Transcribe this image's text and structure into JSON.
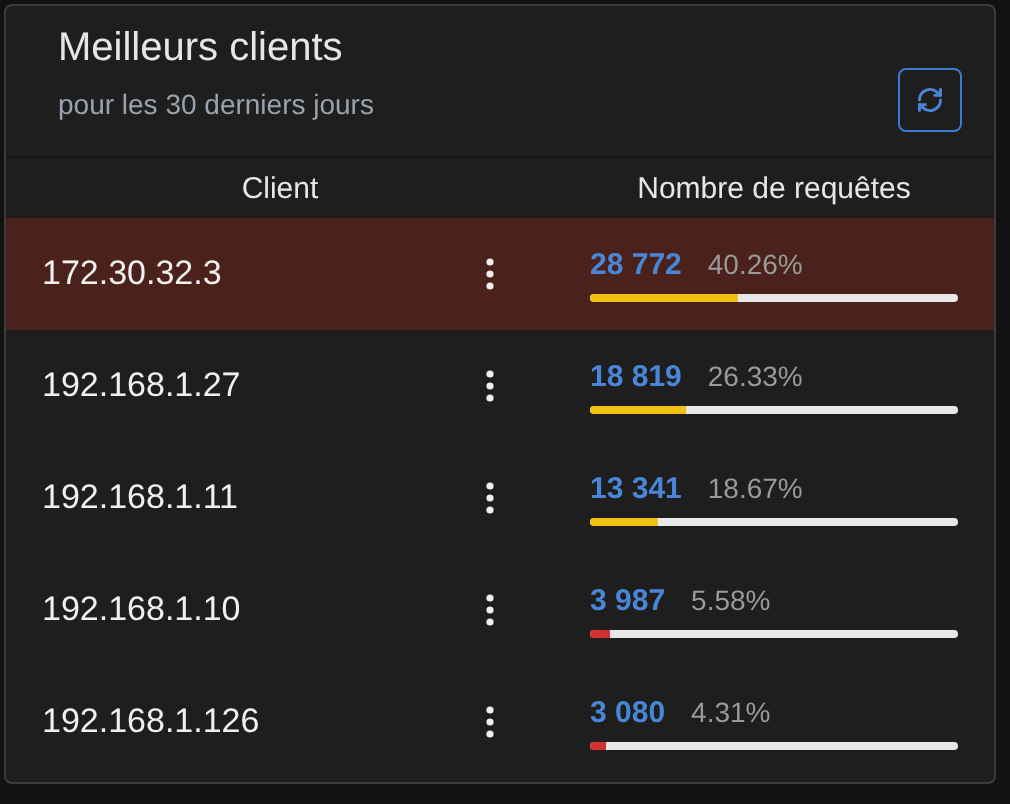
{
  "card": {
    "title": "Meilleurs clients",
    "subtitle": "pour les 30 derniers jours"
  },
  "table": {
    "columns": [
      "Client",
      "Nombre de requêtes"
    ],
    "rows": [
      {
        "client": "172.30.32.3",
        "count": "28 772",
        "percent": "40.26%",
        "level": 0.4026,
        "color": "#f2c10f",
        "selected": true
      },
      {
        "client": "192.168.1.27",
        "count": "18 819",
        "percent": "26.33%",
        "level": 0.2633,
        "color": "#f2c10f",
        "selected": false
      },
      {
        "client": "192.168.1.11",
        "count": "13 341",
        "percent": "18.67%",
        "level": 0.1867,
        "color": "#f2c10f",
        "selected": false
      },
      {
        "client": "192.168.1.10",
        "count": "3 987",
        "percent": "5.58%",
        "level": 0.0558,
        "color": "#d32f2f",
        "selected": false
      },
      {
        "client": "192.168.1.126",
        "count": "3 080",
        "percent": "4.31%",
        "level": 0.0431,
        "color": "#d32f2f",
        "selected": false
      }
    ]
  }
}
